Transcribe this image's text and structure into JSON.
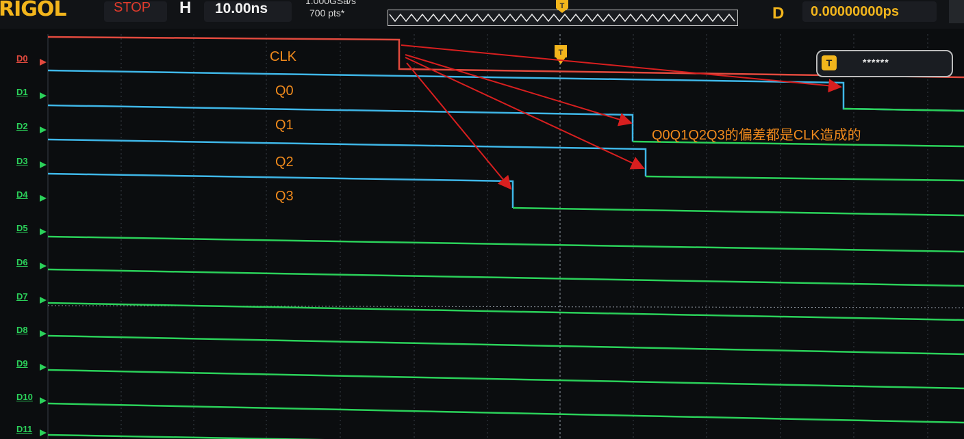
{
  "header": {
    "brand": "RIGOL",
    "run_status": "STOP",
    "horizontal_key": "H",
    "timebase": "10.00ns",
    "sample_rate": "1.000GSa/s",
    "memory_depth": "700  pts*",
    "delay_key": "D",
    "delay_value": "0.00000000ps"
  },
  "trigger_marker": "T",
  "search_box": {
    "icon": "T",
    "value": "******"
  },
  "channels": [
    "D0",
    "D1",
    "D2",
    "D3",
    "D4",
    "D5",
    "D6",
    "D7",
    "D8",
    "D9",
    "D10",
    "D11"
  ],
  "annotations": {
    "clk": "CLK",
    "q0": "Q0",
    "q1": "Q1",
    "q2": "Q2",
    "q3": "Q3",
    "note": "Q0Q1Q2Q3的偏差都是CLK造成的"
  },
  "colors": {
    "clock_trace": "#e24a3e",
    "high_trace": "#3fb7e8",
    "low_trace": "#2bd15a",
    "annotation": "#f08a1c",
    "arrow": "#d81f1f",
    "accent": "#f2b51c"
  }
}
